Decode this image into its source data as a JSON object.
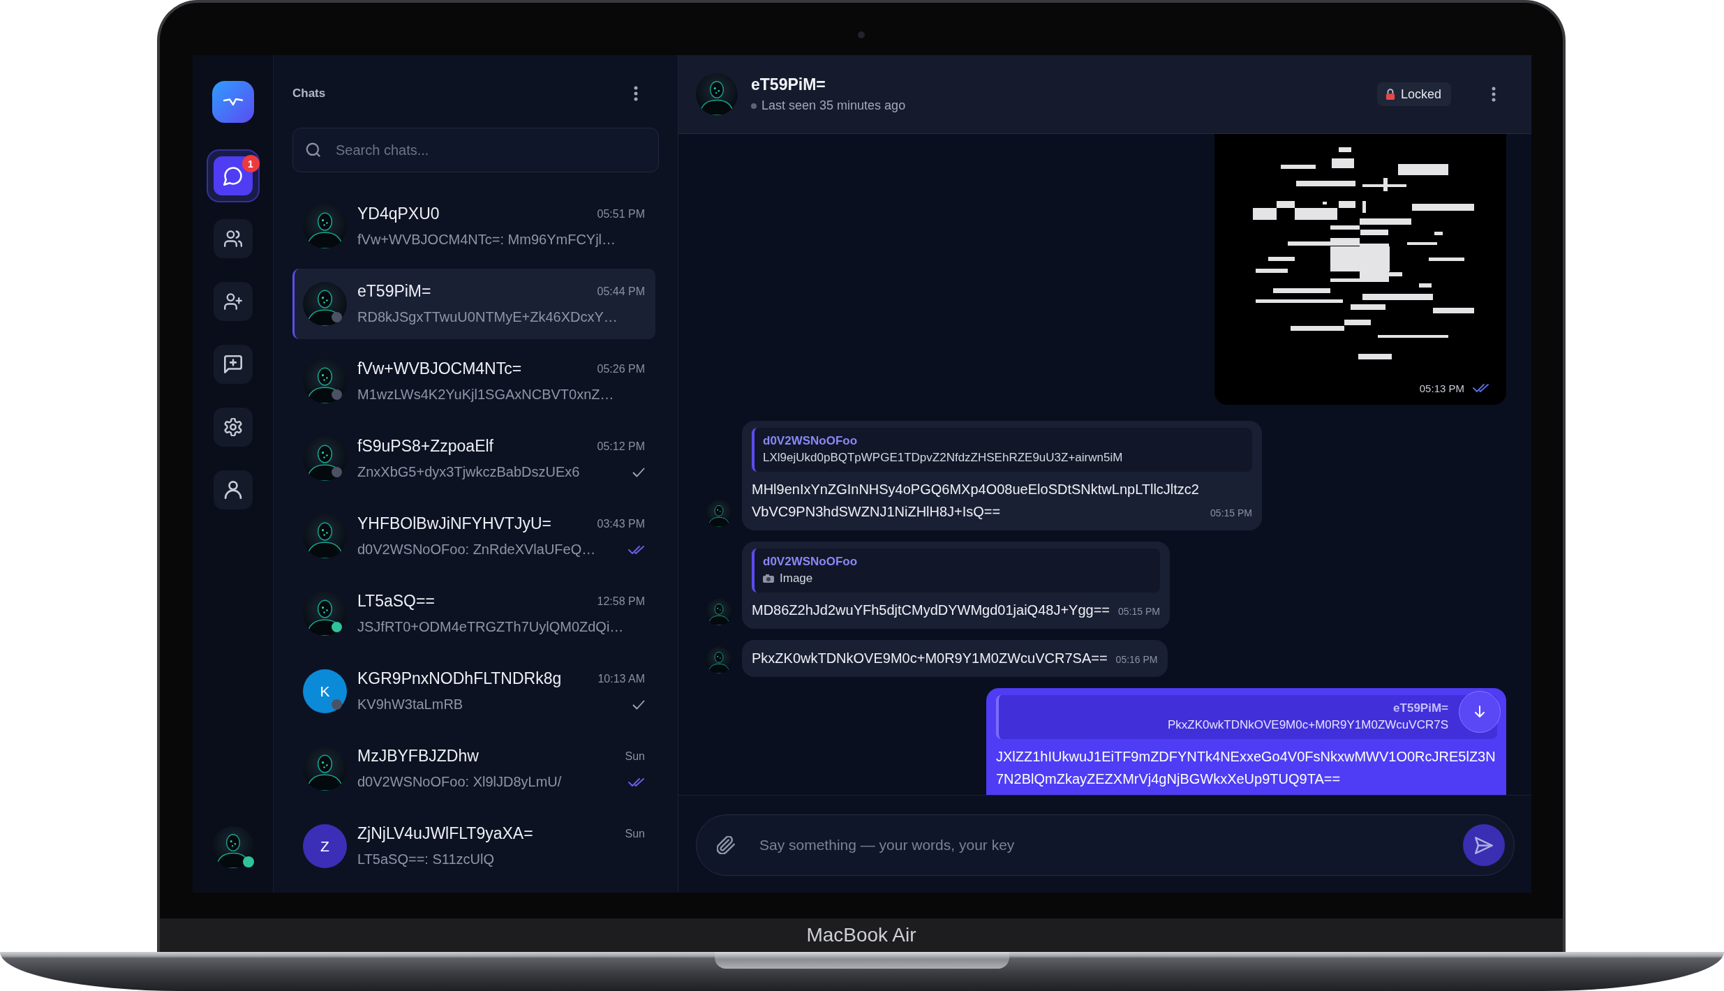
{
  "device": {
    "model_label": "MacBook Air"
  },
  "nav_rail": {
    "items": [
      {
        "kind": "chats",
        "selected": true,
        "badge": "1"
      },
      {
        "kind": "contacts",
        "selected": false
      },
      {
        "kind": "add_contact",
        "selected": false
      },
      {
        "kind": "new_chat",
        "selected": false
      },
      {
        "kind": "settings",
        "selected": false
      },
      {
        "kind": "profile",
        "selected": false
      }
    ],
    "user": {
      "status_dot": {
        "color": "#2fc39a"
      }
    }
  },
  "chat_list": {
    "title": "Chats",
    "search": {
      "placeholder": "Search chats..."
    },
    "chats": [
      {
        "name": "YD4qPXU0",
        "time": "05:51 PM",
        "preview": "fVw+WVBJOCM4NTc=: Mm96YmFCYjl…",
        "avatar": {
          "kind": "silhouette"
        },
        "selected": false
      },
      {
        "name": "eT59PiM=",
        "time": "05:44 PM",
        "preview": "RD8kJSgxTTwuU0NTMyE+Zk46XDcxY…",
        "avatar": {
          "kind": "silhouette"
        },
        "status_dot": {
          "color": "#4c5263"
        },
        "selected": true
      },
      {
        "name": "fVw+WVBJOCM4NTc=",
        "time": "05:26 PM",
        "preview": "M1wzLWs4K2YuKjl1SGAxNCBVT0xnZ…",
        "avatar": {
          "kind": "silhouette"
        },
        "status_dot": {
          "color": "#4c5263"
        },
        "selected": false
      },
      {
        "name": "fS9uPS8+ZzpoaElf",
        "time": "05:12 PM",
        "preview": "ZnxXbG5+dyx3TjwkczBabDszUEx6",
        "avatar": {
          "kind": "silhouette"
        },
        "status_dot": {
          "color": "#4c5263"
        },
        "read": false,
        "selected": false
      },
      {
        "name": "YHFBOlBwJiNFYHVTJyU=",
        "time": "03:43 PM",
        "preview": "d0V2WSNoOFoo: ZnRdeXVlaUFeQ…",
        "avatar": {
          "kind": "silhouette"
        },
        "read": true,
        "selected": false
      },
      {
        "name": "LT5aSQ==",
        "time": "12:58 PM",
        "preview": "JSJfRT0+ODM4eTRGZTh7UylQM0ZdQi…",
        "avatar": {
          "kind": "silhouette"
        },
        "status_dot": {
          "color": "#2fc39a"
        },
        "selected": false
      },
      {
        "name": "KGR9PnxNODhFLTNDRk8g",
        "time": "10:13 AM",
        "preview": "KV9hW3taLmRB",
        "avatar": {
          "kind": "letter",
          "letter": "K",
          "color": "#0b8ad8"
        },
        "status_dot": {
          "color": "#4c5263"
        },
        "read": false,
        "selected": false
      },
      {
        "name": "MzJBYFBJZDhw",
        "time": "Sun",
        "preview": "d0V2WSNoOFoo: Xl9lJD8yLmU/",
        "avatar": {
          "kind": "silhouette"
        },
        "read": true,
        "selected": false
      },
      {
        "name": "ZjNjLV4uJWlFLT9yaXA=",
        "time": "Sun",
        "preview": "LT5aSQ==: S11zcUlQ",
        "avatar": {
          "kind": "letter",
          "letter": "Z",
          "color": "#3b2fb8"
        },
        "selected": false
      }
    ]
  },
  "conversation": {
    "header": {
      "name": "eT59PiM=",
      "status": "Last seen 35 minutes ago",
      "lock_label": "Locked"
    },
    "messages": [
      {
        "kind": "image",
        "outgoing": true,
        "time": "05:13 PM",
        "read": true
      },
      {
        "kind": "text",
        "outgoing": false,
        "reply": {
          "kind": "text",
          "author": "d0V2WSNoOFoo",
          "text": "LXl9ejUkd0pBQTpWPGE1TDpvZ2NfdzZHSEhRZE9uU3Z+airwn5iM"
        },
        "text": "MHl9enIxYnZGInNHSy4oPGQ6MXp4O08ueEloSDtSNktwLnpLTllcJltzc2VbVC9PN3hdSWZNJ1NiZHlH8J+IsQ==",
        "time": "05:15 PM"
      },
      {
        "kind": "text",
        "outgoing": false,
        "reply": {
          "kind": "image",
          "author": "d0V2WSNoOFoo",
          "text": "Image"
        },
        "text": "MD86Z2hJd2wuYFh5djtCMydDYWMgd01jaiQ48J+Ygg==",
        "time": "05:15 PM"
      },
      {
        "kind": "text",
        "outgoing": false,
        "text": "PkxZK0wkTDNkOVE9M0c+M0R9Y1M0ZWcuVCR7SA==",
        "time": "05:16 PM"
      },
      {
        "kind": "text",
        "outgoing": true,
        "reply": {
          "kind": "text",
          "author": "eT59PiM=",
          "text": "PkxZK0wkTDNkOVE9M0c+M0R9Y1M0ZWcuVCR7S"
        },
        "text": "JXlZZ1hIUkwuJ1EiTF9mZDFYNTk4NExxeGo4V0FsNkxwMWV1O0RcJRE5lZ3N7N2BlQmZkayZEZXMrVj4gNjBGWkxXeUp9TUQ9TA=="
      }
    ],
    "composer": {
      "placeholder": "Say something — your words, your key"
    }
  }
}
